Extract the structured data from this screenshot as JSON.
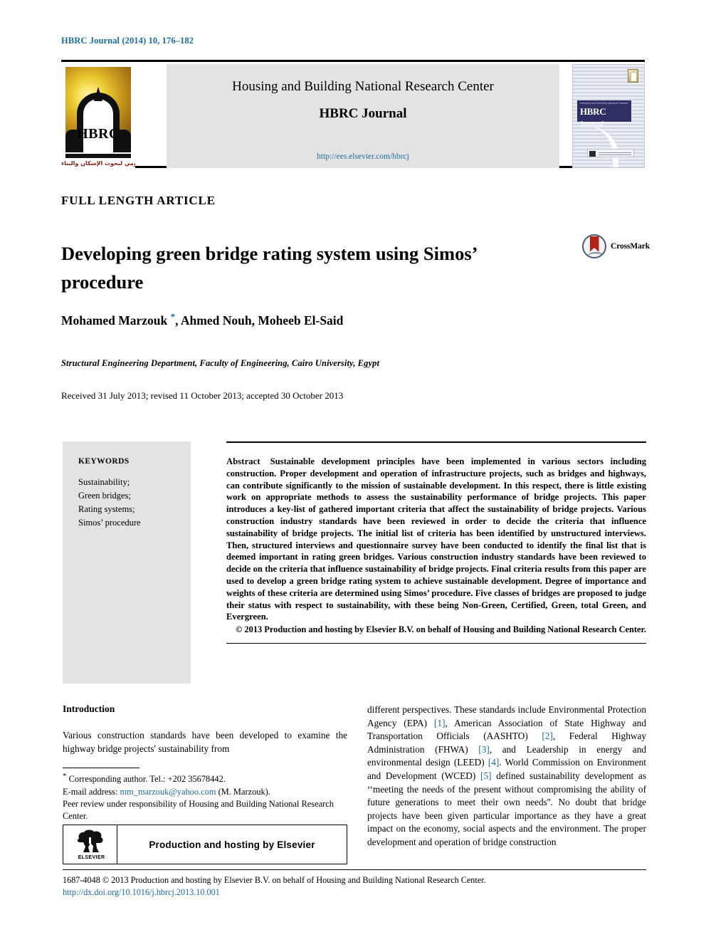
{
  "colors": {
    "link": "#1c6ca1",
    "reference": "#1c6ca1",
    "keywords_bg": "#e3e3e3",
    "masthead_bg": "#e3e3e3",
    "crossmark_ribbon": "#b32117"
  },
  "running_head": "HBRC Journal (2014) 10, 176–182",
  "masthead": {
    "emblem": {
      "acronym": "HBRC",
      "arabic_line": "المركز القومي لبحوث الإسكان والبناء"
    },
    "center_title": "Housing and Building National Research Center",
    "journal_name": "HBRC Journal",
    "url": "http://ees.elsevier.com/hbrcj",
    "cover": {
      "band_small_text": "Housing and Building National Research Center",
      "band_main": "HBRC",
      "band_main_italic": "Journal"
    }
  },
  "article": {
    "type_label": "FULL LENGTH ARTICLE",
    "title": "Developing green bridge rating system using Simos’ procedure",
    "crossmark_label": "CrossMark",
    "authors": "Mohamed Marzouk *, Ahmed Nouh, Moheeb El-Said",
    "authors_prefix": "Mohamed Marzouk ",
    "authors_marker": "*",
    "authors_suffix": ", Ahmed Nouh, Moheeb El-Said",
    "affiliation": "Structural Engineering Department, Faculty of Engineering, Cairo University, Egypt",
    "dates": "Received 31 July 2013; revised 11 October 2013; accepted 30 October 2013"
  },
  "keywords": {
    "heading": "KEYWORDS",
    "items": [
      "Sustainability;",
      "Green bridges;",
      "Rating systems;",
      "Simos’ procedure"
    ]
  },
  "abstract": {
    "heading": "Abstract",
    "body": "Sustainable development principles have been implemented in various sectors including construction. Proper development and operation of infrastructure projects, such as bridges and highways, can contribute significantly to the mission of sustainable development. In this respect, there is little existing work on appropriate methods to assess the sustainability performance of bridge projects. This paper introduces a key-list of gathered important criteria that affect the sustainability of bridge projects. Various construction industry standards have been reviewed in order to decide the criteria that influence sustainability of bridge projects. The initial list of criteria has been identified by unstructured interviews. Then, structured interviews and questionnaire survey have been conducted to identify the final list that is deemed important in rating green bridges. Various construction industry standards have been reviewed to decide on the criteria that influence sustainability of bridge projects. Final criteria results from this paper are used to develop a green bridge rating system to achieve sustainable development. Degree of importance and weights of these criteria are determined using Simos’ procedure. Five classes of bridges are proposed to judge their status with respect to sustainability, with these being Non-Green, Certified, Green, total Green, and Evergreen.",
    "copyright": "© 2013 Production and hosting by Elsevier B.V. on behalf of Housing and Building National Research Center."
  },
  "introduction": {
    "heading": "Introduction",
    "left_paragraph": "Various construction standards have been developed to examine the highway bridge projects' sustainability from",
    "right_paragraph_parts": [
      "different perspectives. These standards include Environmental Protection Agency (EPA) ",
      "[1]",
      ", American Association of State Highway and Transportation Officials (AASHTO) ",
      "[2]",
      ", Federal Highway Administration (FHWA) ",
      "[3]",
      ", and Leadership in energy and environmental design (LEED) ",
      "[4]",
      ". World Commission on Environment and Development (WCED) ",
      "[5]",
      " defined sustainability development as ‘‘meeting the needs of the present without compromising the ability of future generations to meet their own needs''. No doubt that bridge projects have been given particular importance as they have a great impact on the economy, social aspects and the environment. The proper development and operation of bridge construction"
    ]
  },
  "footnotes": {
    "corresponding_marker": "*",
    "corresponding": "Corresponding author. Tel.: +202 35678442.",
    "email_label": "E-mail address:",
    "email": "mm_marzouk@yahoo.com",
    "email_suffix": "(M. Marzouk).",
    "peer_review": "Peer review under responsibility of Housing and Building National Research Center."
  },
  "elsevier_box": {
    "logo_word": "ELSEVIER",
    "text": "Production and hosting by Elsevier"
  },
  "footer": {
    "line1": "1687-4048 © 2013 Production and hosting by Elsevier B.V. on behalf of Housing and Building National Research Center.",
    "doi": "http://dx.doi.org/10.1016/j.hbrcj.2013.10.001"
  }
}
